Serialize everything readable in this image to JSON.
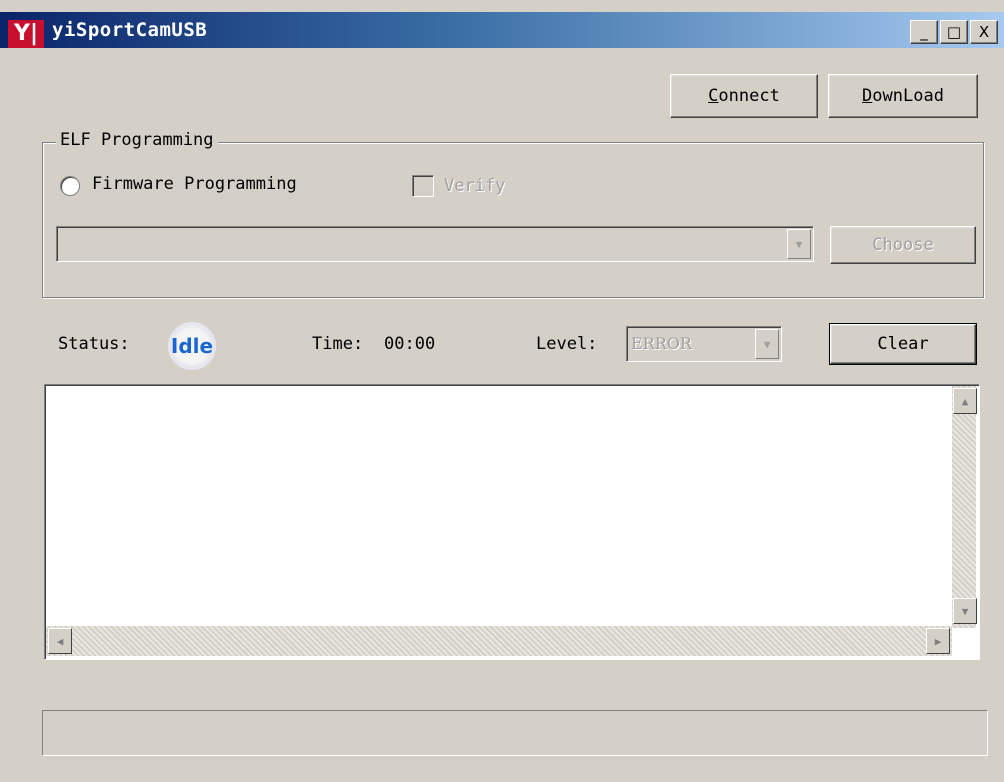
{
  "window": {
    "title": "yiSportCamUSB",
    "icon_text": "Y|"
  },
  "titlebar_buttons": {
    "minimize": "_",
    "maximize": "□",
    "close": "X"
  },
  "toolbar": {
    "connect": {
      "accel": "C",
      "rest": "onnect"
    },
    "download": {
      "accel": "D",
      "rest": "ownLoad"
    }
  },
  "elf_group": {
    "title": "ELF Programming",
    "radio_label": "Firmware Programming",
    "verify_label": "Verify",
    "file_combo_value": "",
    "choose_label": "Choose"
  },
  "status_row": {
    "status_label": "Status:",
    "status_value": "Idle",
    "time_label": "Time:",
    "time_value": "00:00",
    "level_label": "Level:",
    "level_value": "ERROR",
    "clear_label": "Clear"
  },
  "log": {
    "content": ""
  },
  "statusbar": {
    "text": ""
  },
  "colors": {
    "title_start": "#0a246a",
    "title_end": "#a6caf0",
    "face": "#d4d0c8",
    "status_blue": "#1a66d0",
    "icon_red": "#c8102e"
  }
}
